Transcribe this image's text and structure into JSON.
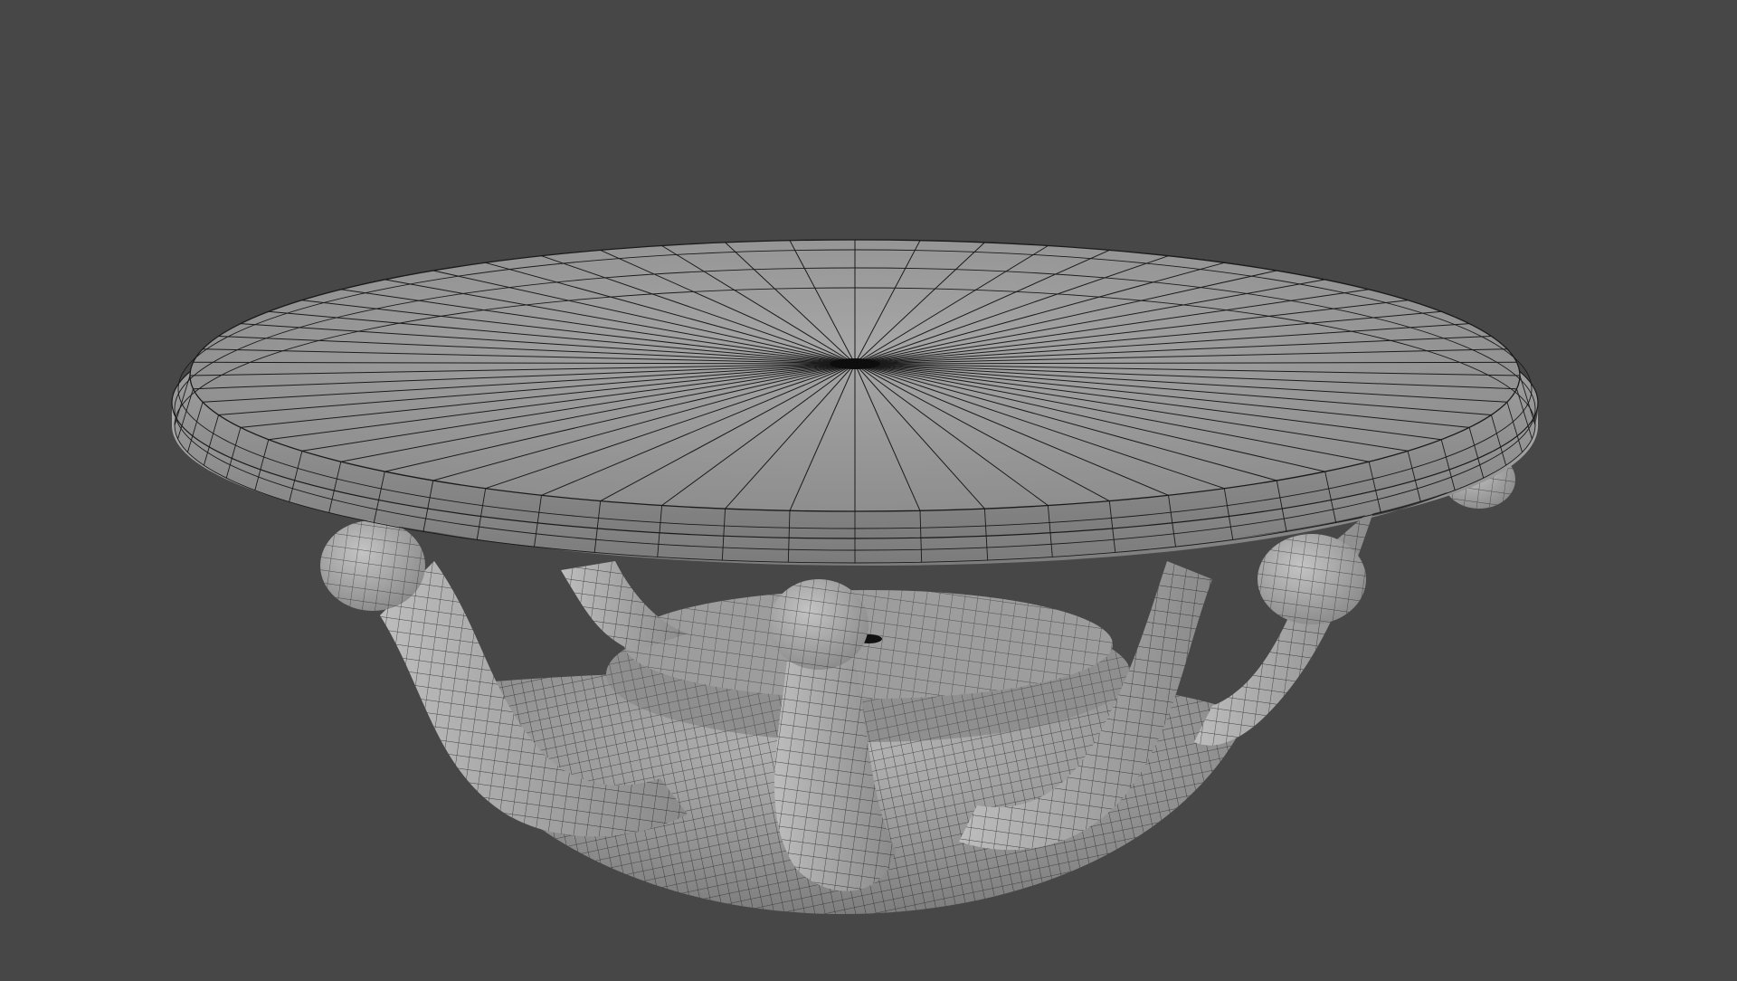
{
  "scene": {
    "background_color": "#474747",
    "shade_light": "#a8a8a8",
    "shade_mid": "#8e8e8e",
    "shade_dark": "#6c6c6c",
    "wire_color": "#1a1a1a"
  }
}
